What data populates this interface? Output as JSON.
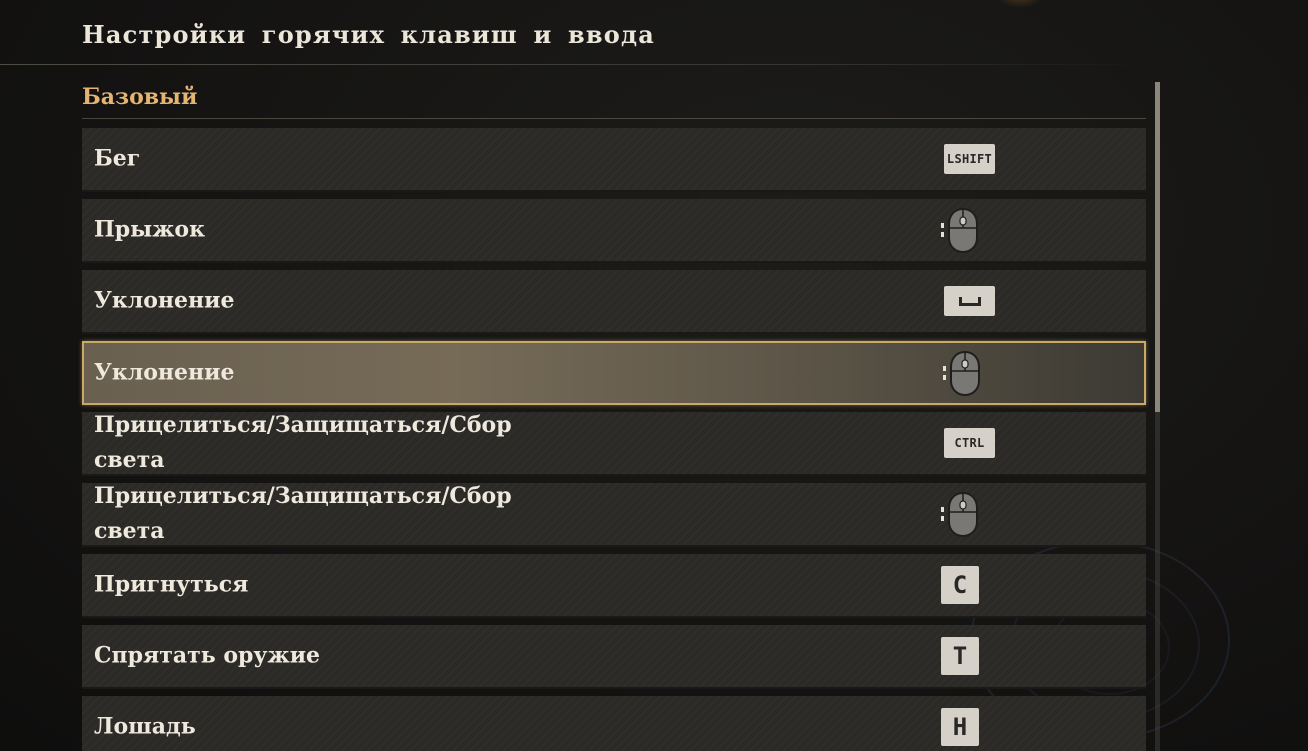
{
  "header": {
    "title": "Настройки горячих клавиш и ввода"
  },
  "section": {
    "title": "Базовый"
  },
  "bindings": [
    {
      "label": "Бег",
      "key": "LSHIFT",
      "key_type": "keycap-wide"
    },
    {
      "label": "Прыжок",
      "key": "",
      "key_type": "mouse-side-button"
    },
    {
      "label": "Уклонение",
      "key": "",
      "key_type": "space-key"
    },
    {
      "label": "Уклонение",
      "key": "",
      "key_type": "mouse-side-button",
      "selected": true
    },
    {
      "label": "Прицелиться/Защищаться/Сбор света",
      "key": "CTRL",
      "key_type": "keycap-wide"
    },
    {
      "label": "Прицелиться/Защищаться/Сбор света",
      "key": "",
      "key_type": "mouse-side-button"
    },
    {
      "label": "Пригнуться",
      "key": "C",
      "key_type": "keycap-small"
    },
    {
      "label": "Спрятать оружие",
      "key": "T",
      "key_type": "keycap-small"
    },
    {
      "label": "Лошадь",
      "key": "H",
      "key_type": "keycap-small"
    }
  ],
  "colors": {
    "section_accent": "#e3b472",
    "selected_border": "#c8a96a",
    "row_bg": "#2b2a27",
    "keycap_bg": "#d6d1c8"
  }
}
